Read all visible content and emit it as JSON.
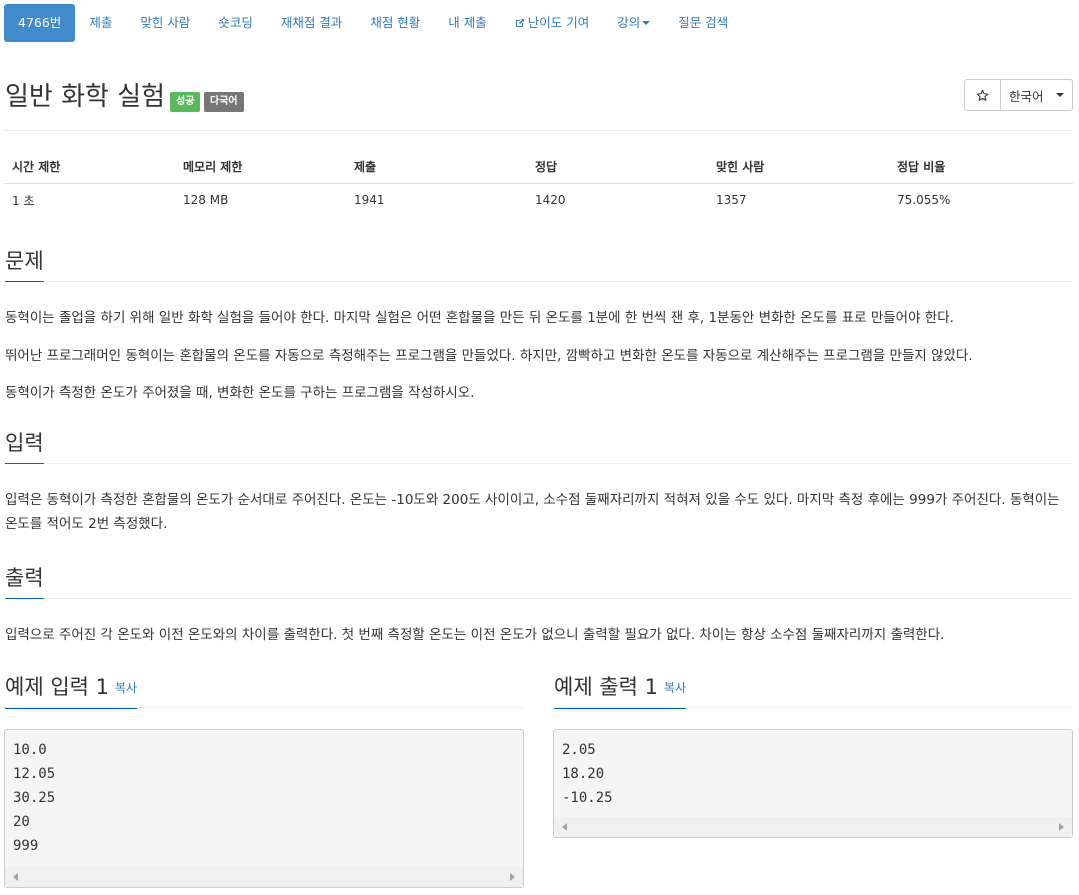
{
  "nav": {
    "tabs": [
      "4766번",
      "제출",
      "맞힌 사람",
      "숏코딩",
      "재채점 결과",
      "채점 현황",
      "내 제출",
      "난이도 기여",
      "강의",
      "질문 검색"
    ],
    "active_index": 0,
    "external_icon": "external-link-icon",
    "dropdown_icon": "caret-down-icon"
  },
  "problem": {
    "title": "일반 화학 실험",
    "badges": [
      "성공",
      "다국어"
    ],
    "star_icon": "star-icon",
    "language": "한국어"
  },
  "info": {
    "headers": [
      "시간 제한",
      "메모리 제한",
      "제출",
      "정답",
      "맞힌 사람",
      "정답 비율"
    ],
    "values": [
      "1 초",
      "128 MB",
      "1941",
      "1420",
      "1357",
      "75.055%"
    ]
  },
  "description": {
    "heading": "문제",
    "paragraphs": [
      "동혁이는 졸업을 하기 위해 일반 화학 실험을 들어야 한다. 마지막 실험은 어떤 혼합물을 만든 뒤 온도를 1분에 한 번씩 잰 후, 1분동안 변화한 온도를 표로 만들어야 한다.",
      "뛰어난 프로그래머인 동혁이는 혼합물의 온도를 자동으로 측정해주는 프로그램을 만들었다. 하지만, 깜빡하고 변화한 온도를 자동으로 계산해주는 프로그램을 만들지 않았다.",
      "동혁이가 측정한 온도가 주어졌을 때, 변화한 온도를 구하는 프로그램을 작성하시오."
    ]
  },
  "input": {
    "heading": "입력",
    "text": "입력은 동혁이가 측정한 혼합물의 온도가 순서대로 주어진다. 온도는 -10도와 200도 사이이고, 소수점 둘째자리까지 적혀져 있을 수도 있다. 마지막 측정 후에는 999가 주어진다. 동혁이는 온도를 적어도 2번 측정했다."
  },
  "output": {
    "heading": "출력",
    "text": "입력으로 주어진 각 온도와 이전 온도와의 차이를 출력한다. 첫 번째 측정할 온도는 이전 온도가 없으니 출력할 필요가 없다. 차이는 항상 소수점 둘째자리까지 출력한다."
  },
  "samples": {
    "input": {
      "heading": "예제 입력 1",
      "copy": "복사",
      "lines": [
        "10.0",
        "12.05",
        "30.25",
        "20",
        "999"
      ]
    },
    "output": {
      "heading": "예제 출력 1",
      "copy": "복사",
      "lines": [
        "2.05",
        "18.20",
        "-10.25"
      ]
    }
  }
}
